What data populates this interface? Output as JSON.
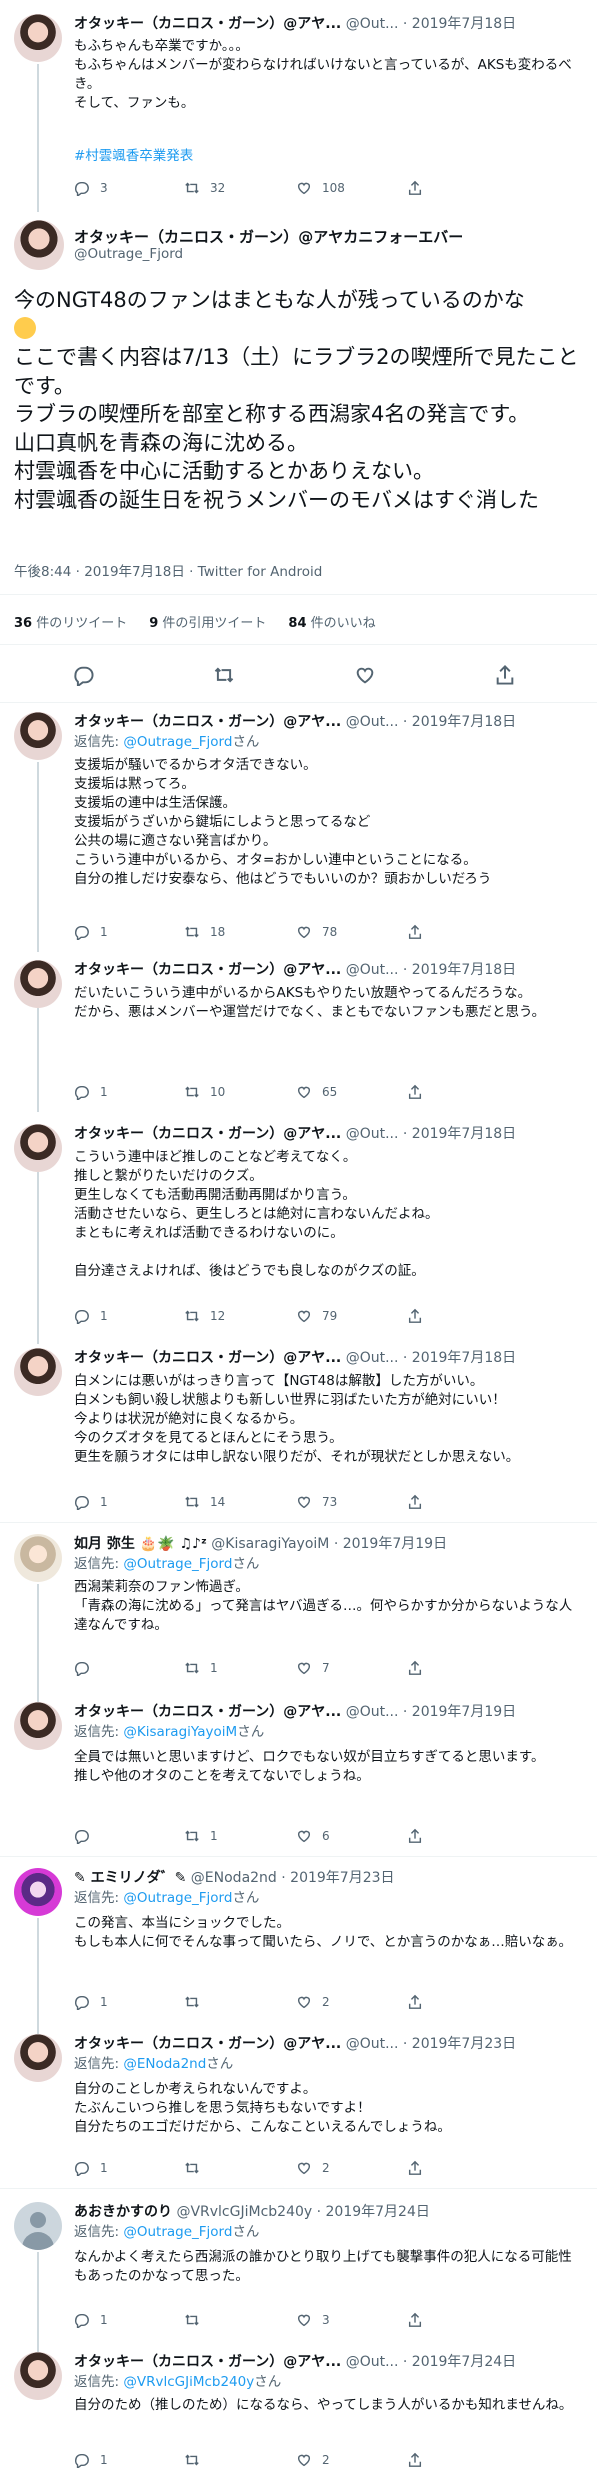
{
  "icons": {
    "reply": "reply-icon",
    "retweet": "retweet-icon",
    "like": "heart-icon",
    "share": "share-icon",
    "think": "thinking-face-emoji"
  },
  "colors": {
    "accent": "#1d9bf0",
    "text": "#0f1419",
    "muted": "#536471",
    "divider": "#eff3f4"
  },
  "parent_tweet": {
    "name": "オタッキー（カニロス・ガーン）@アヤ...",
    "handle": "@Out...",
    "date": "· 2019年7月18日",
    "text": "もふちゃんも卒業ですか。。。\nもふちゃんはメンバーが変わらなければいけないと言っているが、AKSも変わるべき。\nそして、ファンも。",
    "hashtag": "#村雲颯香卒業発表",
    "counts": {
      "reply": "3",
      "retweet": "32",
      "like": "108"
    }
  },
  "main_tweet": {
    "name": "オタッキー（カニロス・ガーン）@アヤカニフォーエバー",
    "handle": "@Outrage_Fjord",
    "text_1": "今のNGT48のファンはまともな人が残っているのかな",
    "text_2": "\nここで書く内容は7/13（土）にラブラ2の喫煙所で見たことです。\nラブラの喫煙所を部室と称する西潟家4名の発言です。\n山口真帆を青森の海に沈める。\n村雲颯香を中心に活動するとかありえない。\n村雲颯香の誕生日を祝うメンバーのモバメはすぐ消した",
    "meta": "午後8:44 · 2019年7月18日 · Twitter for Android",
    "retweets_num": "36",
    "retweets_label": " 件のリツイート",
    "quotes_num": "9",
    "quotes_label": " 件の引用ツイート",
    "likes_num": "84",
    "likes_label": " 件のいいね"
  },
  "replies": [
    {
      "name": "オタッキー（カニロス・ガーン）@アヤ...",
      "handle": "@Out...",
      "date": "· 2019年7月18日",
      "reply_prefix": "返信先: ",
      "reply_mention": "@Outrage_Fjord",
      "reply_suffix": "さん",
      "text": "支援垢が騒いでるからオタ活できない。\n支援垢は黙ってろ。\n支援垢の連中は生活保護。\n支援垢がうざいから鍵垢にしようと思ってるなど\n公共の場に適さない発言ばかり。\nこういう連中がいるから、オタ=おかしい連中ということになる。\n自分の推しだけ安泰なら、他はどうでもいいのか？頭おかしいだろう",
      "counts": {
        "reply": "1",
        "retweet": "18",
        "like": "78"
      }
    },
    {
      "name": "オタッキー（カニロス・ガーン）@アヤ...",
      "handle": "@Out...",
      "date": "· 2019年7月18日",
      "text": "だいたいこういう連中がいるからAKSもやりたい放題やってるんだろうな。\nだから、悪はメンバーや運営だけでなく、まともでないファンも悪だと思う。",
      "counts": {
        "reply": "1",
        "retweet": "10",
        "like": "65"
      }
    },
    {
      "name": "オタッキー（カニロス・ガーン）@アヤ...",
      "handle": "@Out...",
      "date": "· 2019年7月18日",
      "text": "こういう連中ほど推しのことなど考えてなく。\n推しと繋がりたいだけのクズ。\n更生しなくても活動再開活動再開ばかり言う。\n活動させたいなら、更生しろとは絶対に言わないんだよね。\nまともに考えれば活動できるわけないのに。\n\n自分達さえよければ、後はどうでも良しなのがクズの証。",
      "counts": {
        "reply": "1",
        "retweet": "12",
        "like": "79"
      }
    },
    {
      "name": "オタッキー（カニロス・ガーン）@アヤ...",
      "handle": "@Out...",
      "date": "· 2019年7月18日",
      "text": "白メンには悪いがはっきり言って【NGT48は解散】した方がいい。\n白メンも飼い殺し状態よりも新しい世界に羽ばたいた方が絶対にいい！\n今よりは状況が絶対に良くなるから。\n今のクズオタを見てるとほんとにそう思う。\n更生を願うオタには申し訳ない限りだが、それが現状だとしか思えない。",
      "counts": {
        "reply": "1",
        "retweet": "14",
        "like": "73"
      }
    },
    {
      "name": "如月 弥生",
      "emoji_tail": " 🎂🪴 ♫♪ᶻ",
      "handle": "@KisaragiYayoiM",
      "date": "· 2019年7月19日",
      "reply_prefix": "返信先: ",
      "reply_mention": "@Outrage_Fjord",
      "reply_suffix": "さん",
      "text": "西潟茉莉奈のファン怖過ぎ。\n「青森の海に沈める」って発言はヤバ過ぎる…。何やらかすか分からないような人達なんですね。",
      "counts": {
        "reply": "",
        "retweet": "1",
        "like": "7"
      }
    },
    {
      "name": "オタッキー（カニロス・ガーン）@アヤ...",
      "handle": "@Out...",
      "date": "· 2019年7月19日",
      "reply_prefix": "返信先: ",
      "reply_mention": "@KisaragiYayoiM",
      "reply_suffix": "さん",
      "text": "全員では無いと思いますけど、ロクでもない奴が目立ちすぎてると思います。\n推しや他のオタのことを考えてないでしょうね。",
      "counts": {
        "reply": "",
        "retweet": "1",
        "like": "6"
      }
    },
    {
      "name": "✎ エミリノダ゛✎",
      "handle": "@ENoda2nd",
      "date": "· 2019年7月23日",
      "reply_prefix": "返信先: ",
      "reply_mention": "@Outrage_Fjord",
      "reply_suffix": "さん",
      "text": "この発言、本当にショックでした。\nもしも本人に何でそんな事って聞いたら、ノリで、とか言うのかなぁ…賠いなぁ。",
      "counts": {
        "reply": "1",
        "retweet": "",
        "like": "2"
      }
    },
    {
      "name": "オタッキー（カニロス・ガーン）@アヤ...",
      "handle": "@Out...",
      "date": "· 2019年7月23日",
      "reply_prefix": "返信先: ",
      "reply_mention": "@ENoda2nd",
      "reply_suffix": "さん",
      "text": "自分のことしか考えられないんですよ。\nたぶんこいつら推しを思う気持ちもないですよ！\n自分たちのエゴだけだから、こんなこといえるんでしょうね。",
      "counts": {
        "reply": "1",
        "retweet": "",
        "like": "2"
      }
    },
    {
      "name": "あおきかすのり",
      "handle": "@VRvlcGJiMcb240y",
      "date": "· 2019年7月24日",
      "reply_prefix": "返信先: ",
      "reply_mention": "@Outrage_Fjord",
      "reply_suffix": "さん",
      "text": "なんかよく考えたら西潟派の誰かひとり取り上げても襲撃事件の犯人になる可能性もあったのかなって思った。",
      "counts": {
        "reply": "1",
        "retweet": "",
        "like": "3"
      }
    },
    {
      "name": "オタッキー（カニロス・ガーン）@アヤ...",
      "handle": "@Out...",
      "date": "· 2019年7月24日",
      "reply_prefix": "返信先: ",
      "reply_mention": "@VRvlcGJiMcb240y",
      "reply_suffix": "さん",
      "text": "自分のため（推しのため）になるなら、やってしまう人がいるかも知れませんね。",
      "counts": {
        "reply": "1",
        "retweet": "",
        "like": "2"
      }
    }
  ]
}
